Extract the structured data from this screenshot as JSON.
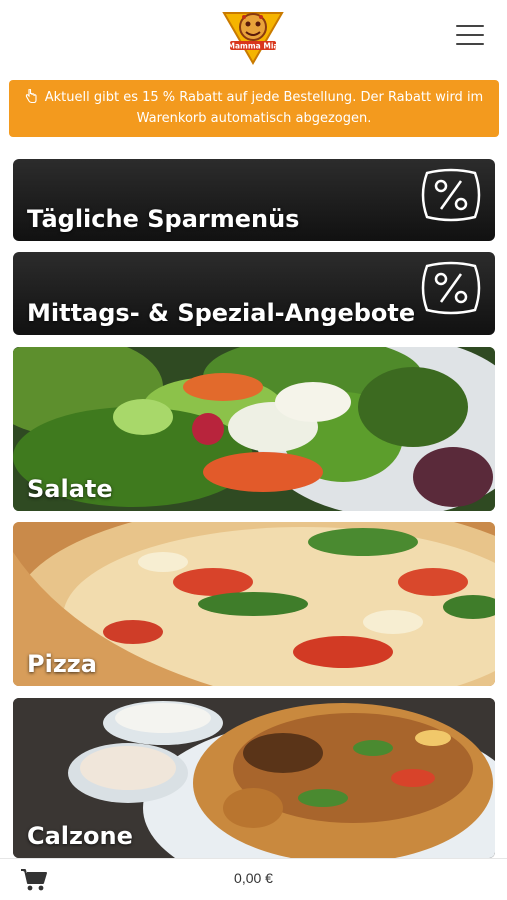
{
  "header": {
    "logo_text": "Mamma Mia",
    "menu_icon": "hamburger-icon"
  },
  "promo": {
    "icon": "hand-pointer-icon",
    "text": "Aktuell gibt es 15 % Rabatt auf jede Bestellung. Der Rabatt wird im Warenkorb automatisch abgezogen."
  },
  "categories": [
    {
      "label": "Tägliche Sparmenüs",
      "icon": "percent-badge-icon"
    },
    {
      "label": "Mittags- & Spezial-Angebote",
      "icon": "percent-badge-icon"
    },
    {
      "label": "Salate",
      "image": "salad-photo"
    },
    {
      "label": "Pizza",
      "image": "pizza-photo"
    },
    {
      "label": "Calzone",
      "image": "calzone-photo"
    }
  ],
  "cart": {
    "icon": "cart-icon",
    "total": "0,00 €"
  },
  "colors": {
    "accent": "#f39a1e",
    "tile_dark": "#1c1c1c"
  }
}
